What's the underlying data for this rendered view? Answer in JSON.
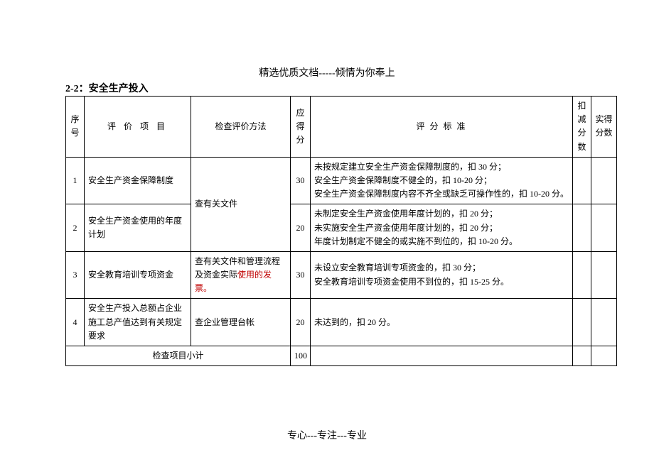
{
  "header": "精选优质文档-----倾情为你奉上",
  "section_title": "2-2：安全生产投入",
  "footer": "专心---专注---专业",
  "table": {
    "headers": {
      "seq": "序号",
      "item": "评 价 项 目",
      "method": "检查评价方法",
      "possible": "应得分",
      "criteria": "评 分 标 准",
      "deduct": "扣减分数",
      "actual": "实得分数"
    },
    "method_merged_1_2": "查有关文件",
    "rows": [
      {
        "seq": "1",
        "item": "安全生产资金保障制度",
        "possible": "30",
        "criteria": [
          "未按规定建立安全生产资金保障制度的，扣 30 分；",
          "安全生产资金保障制度不健全的，扣 10-20 分；",
          "安全生产资金保障制度内容不齐全或缺乏可操作性的，扣 10-20 分。"
        ],
        "deduct": "",
        "actual": ""
      },
      {
        "seq": "2",
        "item": "安全生产资金使用的年度计划",
        "possible": "20",
        "criteria": [
          "未制定安全生产资金使用年度计划的，扣 20 分；",
          "未实施安全生产资金使用年度计划的，扣 20 分；",
          "年度计划制定不健全的或实施不到位的，扣 10-20 分。"
        ],
        "deduct": "",
        "actual": ""
      },
      {
        "seq": "3",
        "item": "安全教育培训专项资金",
        "method_prefix": "查有关文件和管理流程及资金实际",
        "method_red": "使用的发票。",
        "possible": "30",
        "criteria": [
          "未设立安全教育培训专项资金的，扣 30 分；",
          "安全教育培训专项资金使用不到位的，扣 15-25 分。"
        ],
        "deduct": "",
        "actual": ""
      },
      {
        "seq": "4",
        "item": "安全生产投入总额占企业施工总产值达到有关规定要求",
        "method": "查企业管理台帐",
        "possible": "20",
        "criteria": [
          "未达到的，扣 20 分。"
        ],
        "deduct": "",
        "actual": ""
      }
    ],
    "subtotal": {
      "label": "检查项目小计",
      "value": "100"
    }
  }
}
